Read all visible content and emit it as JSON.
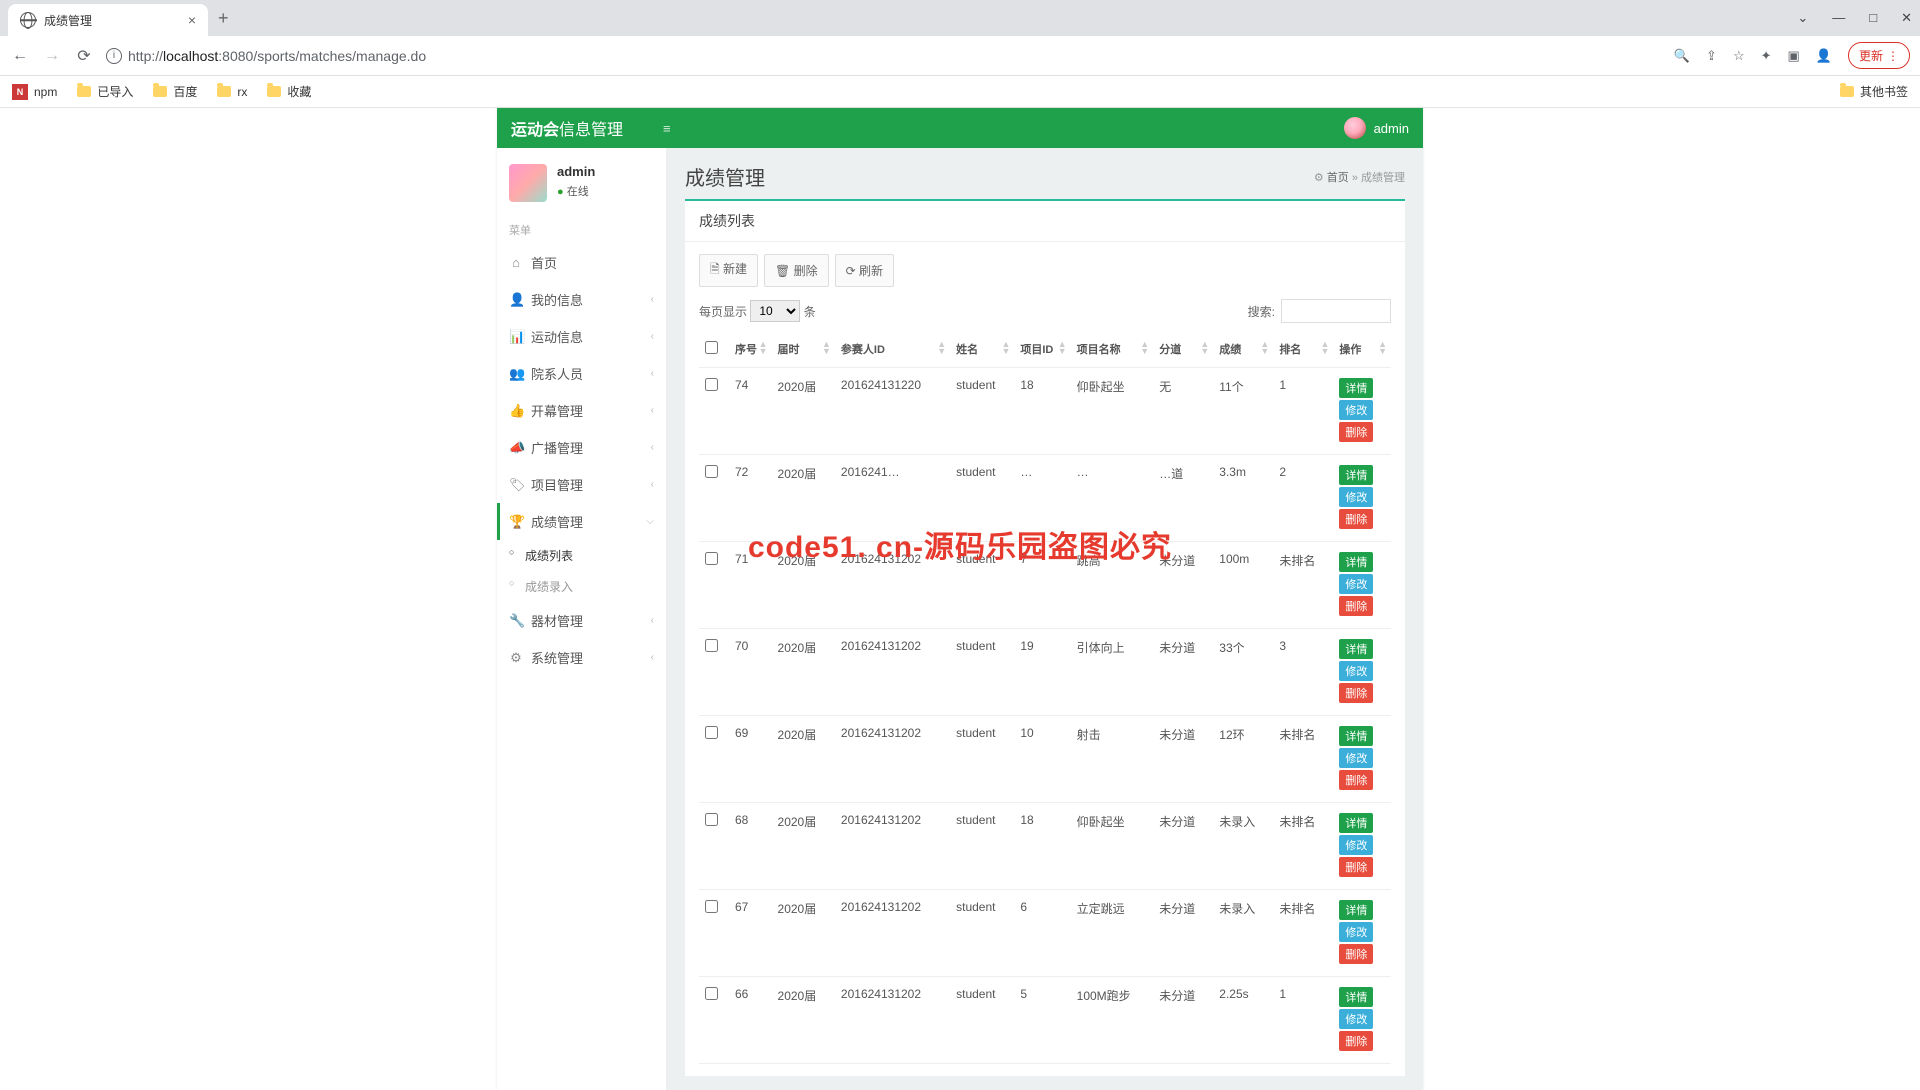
{
  "browser": {
    "tab_title": "成绩管理",
    "url_prefix": "http://",
    "url_host": "localhost",
    "url_port": ":8080",
    "url_path": "/sports/matches/manage.do",
    "update_label": "更新"
  },
  "bookmarks": {
    "items": [
      {
        "label": "npm"
      },
      {
        "label": "已导入"
      },
      {
        "label": "百度"
      },
      {
        "label": "rx"
      },
      {
        "label": "收藏"
      }
    ],
    "other": "其他书签"
  },
  "app": {
    "logo_bold": "运动会",
    "logo_rest": "信息管理",
    "username": "admin"
  },
  "sidebar": {
    "user_name": "admin",
    "user_status": "在线",
    "menu_header": "菜单",
    "items": [
      {
        "icon": "⌂",
        "label": "首页",
        "expandable": false
      },
      {
        "icon": "👤",
        "label": "我的信息",
        "expandable": true
      },
      {
        "icon": "📊",
        "label": "运动信息",
        "expandable": true
      },
      {
        "icon": "👥",
        "label": "院系人员",
        "expandable": true
      },
      {
        "icon": "👍",
        "label": "开幕管理",
        "expandable": true
      },
      {
        "icon": "📣",
        "label": "广播管理",
        "expandable": true
      },
      {
        "icon": "🏷",
        "label": "项目管理",
        "expandable": true
      },
      {
        "icon": "🏆",
        "label": "成绩管理",
        "expandable": true,
        "active": true
      },
      {
        "icon": "🔧",
        "label": "器材管理",
        "expandable": true
      },
      {
        "icon": "⚙",
        "label": "系统管理",
        "expandable": true
      }
    ],
    "active_sub": [
      {
        "label": "成绩列表",
        "active": true
      },
      {
        "label": "成绩录入",
        "active": false
      }
    ]
  },
  "page": {
    "title": "成绩管理",
    "bc_home": "首页",
    "bc_sep": "»",
    "bc_current": "成绩管理",
    "panel_header": "成绩列表"
  },
  "toolbar": {
    "new": "新建",
    "delete": "删除",
    "refresh": "刷新"
  },
  "datatable": {
    "per_page_prefix": "每页显示",
    "per_page_value": "10",
    "per_page_suffix": "条",
    "search_label": "搜索:"
  },
  "columns": {
    "c0": "",
    "c1": "序号",
    "c2": "届时",
    "c3": "参赛人ID",
    "c4": "姓名",
    "c5": "项目ID",
    "c6": "项目名称",
    "c7": "分道",
    "c8": "成绩",
    "c9": "排名",
    "c10": "操作"
  },
  "ops": {
    "detail": "详情",
    "edit": "修改",
    "del": "删除"
  },
  "rows": [
    {
      "seq": "74",
      "term": "2020届",
      "pid": "201624131220",
      "name": "student",
      "evid": "18",
      "evname": "仰卧起坐",
      "lane": "无",
      "score": "11个",
      "rank": "1"
    },
    {
      "seq": "72",
      "term": "2020届",
      "pid": "2016241…",
      "name": "student",
      "evid": "…",
      "evname": "…",
      "lane": "…道",
      "score": "3.3m",
      "rank": "2"
    },
    {
      "seq": "71",
      "term": "2020届",
      "pid": "201624131202",
      "name": "student",
      "evid": "7",
      "evname": "跳高",
      "lane": "未分道",
      "score": "100m",
      "rank": "未排名"
    },
    {
      "seq": "70",
      "term": "2020届",
      "pid": "201624131202",
      "name": "student",
      "evid": "19",
      "evname": "引体向上",
      "lane": "未分道",
      "score": "33个",
      "rank": "3"
    },
    {
      "seq": "69",
      "term": "2020届",
      "pid": "201624131202",
      "name": "student",
      "evid": "10",
      "evname": "射击",
      "lane": "未分道",
      "score": "12环",
      "rank": "未排名"
    },
    {
      "seq": "68",
      "term": "2020届",
      "pid": "201624131202",
      "name": "student",
      "evid": "18",
      "evname": "仰卧起坐",
      "lane": "未分道",
      "score": "未录入",
      "rank": "未排名"
    },
    {
      "seq": "67",
      "term": "2020届",
      "pid": "201624131202",
      "name": "student",
      "evid": "6",
      "evname": "立定跳远",
      "lane": "未分道",
      "score": "未录入",
      "rank": "未排名"
    },
    {
      "seq": "66",
      "term": "2020届",
      "pid": "201624131202",
      "name": "student",
      "evid": "5",
      "evname": "100M跑步",
      "lane": "未分道",
      "score": "2.25s",
      "rank": "1"
    }
  ],
  "watermark": "code51. cn-源码乐园盗图必究"
}
